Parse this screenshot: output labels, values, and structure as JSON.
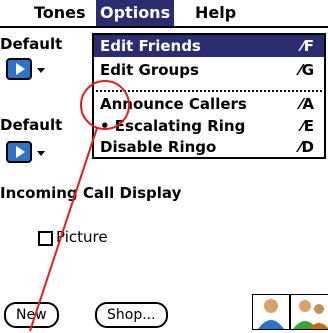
{
  "menubar": {
    "menus": [
      "Tones",
      "Options",
      "Help"
    ],
    "active": "Options"
  },
  "dropdown": {
    "items": [
      {
        "label": "Edit Friends",
        "shortcut": "F",
        "selected": true
      },
      {
        "label": "Edit Groups",
        "shortcut": "G",
        "selected": false
      },
      {
        "label": "Announce Callers",
        "shortcut": "A",
        "selected": false
      },
      {
        "label": "• Escalating Ring",
        "shortcut": "E",
        "selected": false
      },
      {
        "label": "Disable Ringo",
        "shortcut": "D",
        "selected": false
      }
    ],
    "shortcut_glyph": "⁄"
  },
  "form": {
    "default_label_1": "Default",
    "default_label_2": "Default",
    "incoming_heading": "Incoming Call Display",
    "picture_label": "Picture",
    "picture_checked": false,
    "new_button": "New",
    "shop_button": "Shop..."
  },
  "colors": {
    "menu_highlight": "#2c2c70",
    "play_button": "#2e74c6",
    "annotation": "#e0201c"
  }
}
